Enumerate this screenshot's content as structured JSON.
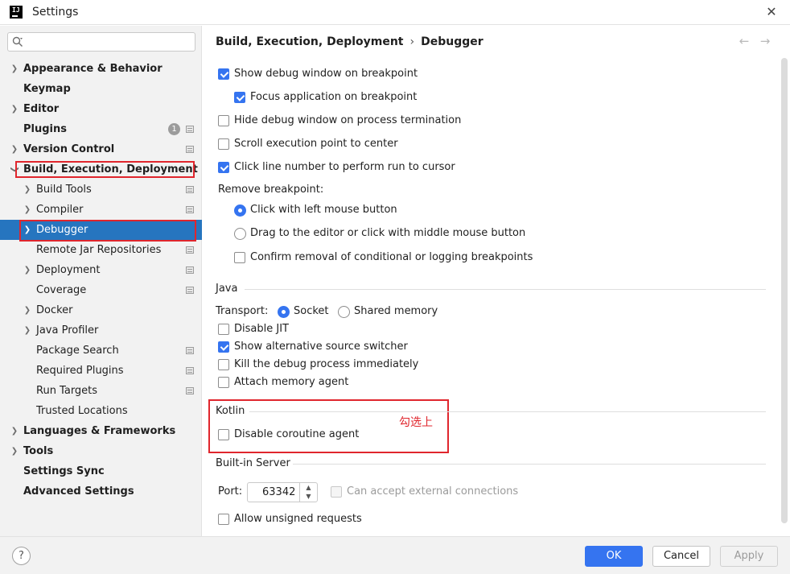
{
  "window": {
    "title": "Settings",
    "logo_text": "IJ",
    "close_glyph": "✕"
  },
  "sidebar": {
    "search": {
      "placeholder": "",
      "value": ""
    },
    "items": [
      {
        "label": "Appearance & Behavior",
        "expandable": true,
        "bold": true
      },
      {
        "label": "Keymap",
        "bold": true
      },
      {
        "label": "Editor",
        "expandable": true,
        "bold": true
      },
      {
        "label": "Plugins",
        "bold": true,
        "badge": "1"
      },
      {
        "label": "Version Control",
        "expandable": true,
        "bold": true
      },
      {
        "label": "Build, Execution, Deployment",
        "expanded": true,
        "bold": true
      },
      {
        "label": "Build Tools",
        "expandable": true
      },
      {
        "label": "Compiler",
        "expandable": true
      },
      {
        "label": "Debugger",
        "expandable": true,
        "selected": true
      },
      {
        "label": "Remote Jar Repositories"
      },
      {
        "label": "Deployment",
        "expandable": true
      },
      {
        "label": "Coverage"
      },
      {
        "label": "Docker",
        "expandable": true
      },
      {
        "label": "Java Profiler",
        "expandable": true
      },
      {
        "label": "Package Search"
      },
      {
        "label": "Required Plugins"
      },
      {
        "label": "Run Targets"
      },
      {
        "label": "Trusted Locations"
      },
      {
        "label": "Languages & Frameworks",
        "expandable": true,
        "bold": true
      },
      {
        "label": "Tools",
        "expandable": true,
        "bold": true
      },
      {
        "label": "Settings Sync",
        "bold": true
      },
      {
        "label": "Advanced Settings",
        "bold": true
      }
    ]
  },
  "breadcrumb": {
    "parent": "Build, Execution, Deployment",
    "separator": "›",
    "current": "Debugger",
    "back_glyph": "←",
    "forward_glyph": "→"
  },
  "debugger": {
    "show_debug_window": {
      "label": "Show debug window on breakpoint",
      "checked": true
    },
    "focus_application": {
      "label": "Focus application on breakpoint",
      "checked": true
    },
    "hide_debug_window": {
      "label": "Hide debug window on process termination",
      "checked": false
    },
    "scroll_execution": {
      "label": "Scroll execution point to center",
      "checked": false
    },
    "click_line_number": {
      "label": "Click line number to perform run to cursor",
      "checked": true
    },
    "remove_breakpoint_label": "Remove breakpoint:",
    "remove_left_click": {
      "label": "Click with left mouse button",
      "selected": true
    },
    "remove_drag": {
      "label": "Drag to the editor or click with middle mouse button",
      "selected": false
    },
    "confirm_removal": {
      "label": "Confirm removal of conditional or logging breakpoints",
      "checked": false
    }
  },
  "java": {
    "section_title": "Java",
    "transport_label": "Transport:",
    "transport_socket": {
      "label": "Socket",
      "selected": true
    },
    "transport_shared": {
      "label": "Shared memory",
      "selected": false
    },
    "disable_jit": {
      "label": "Disable JIT",
      "checked": false
    },
    "alt_source_switcher": {
      "label": "Show alternative source switcher",
      "checked": true
    },
    "kill_debug_process": {
      "label": "Kill the debug process immediately",
      "checked": false
    },
    "attach_memory_agent": {
      "label": "Attach memory agent",
      "checked": false
    }
  },
  "kotlin": {
    "section_title": "Kotlin",
    "disable_coroutine_agent": {
      "label": "Disable coroutine agent",
      "checked": false
    }
  },
  "annotation": {
    "text": "勾选上",
    "color": "#e0262d"
  },
  "builtin_server": {
    "section_title": "Built-in Server",
    "port_label": "Port:",
    "port_value": "63342",
    "can_accept_external": {
      "label": "Can accept external connections",
      "checked": false,
      "enabled": false
    },
    "allow_unsigned": {
      "label": "Allow unsigned requests",
      "checked": false
    }
  },
  "footer": {
    "help_glyph": "?",
    "ok_label": "OK",
    "cancel_label": "Cancel",
    "apply_label": "Apply"
  },
  "colors": {
    "accent": "#3574f0",
    "selection": "#2675bf",
    "highlight_border": "#e0262d",
    "sidebar_bg": "#f2f2f2"
  }
}
